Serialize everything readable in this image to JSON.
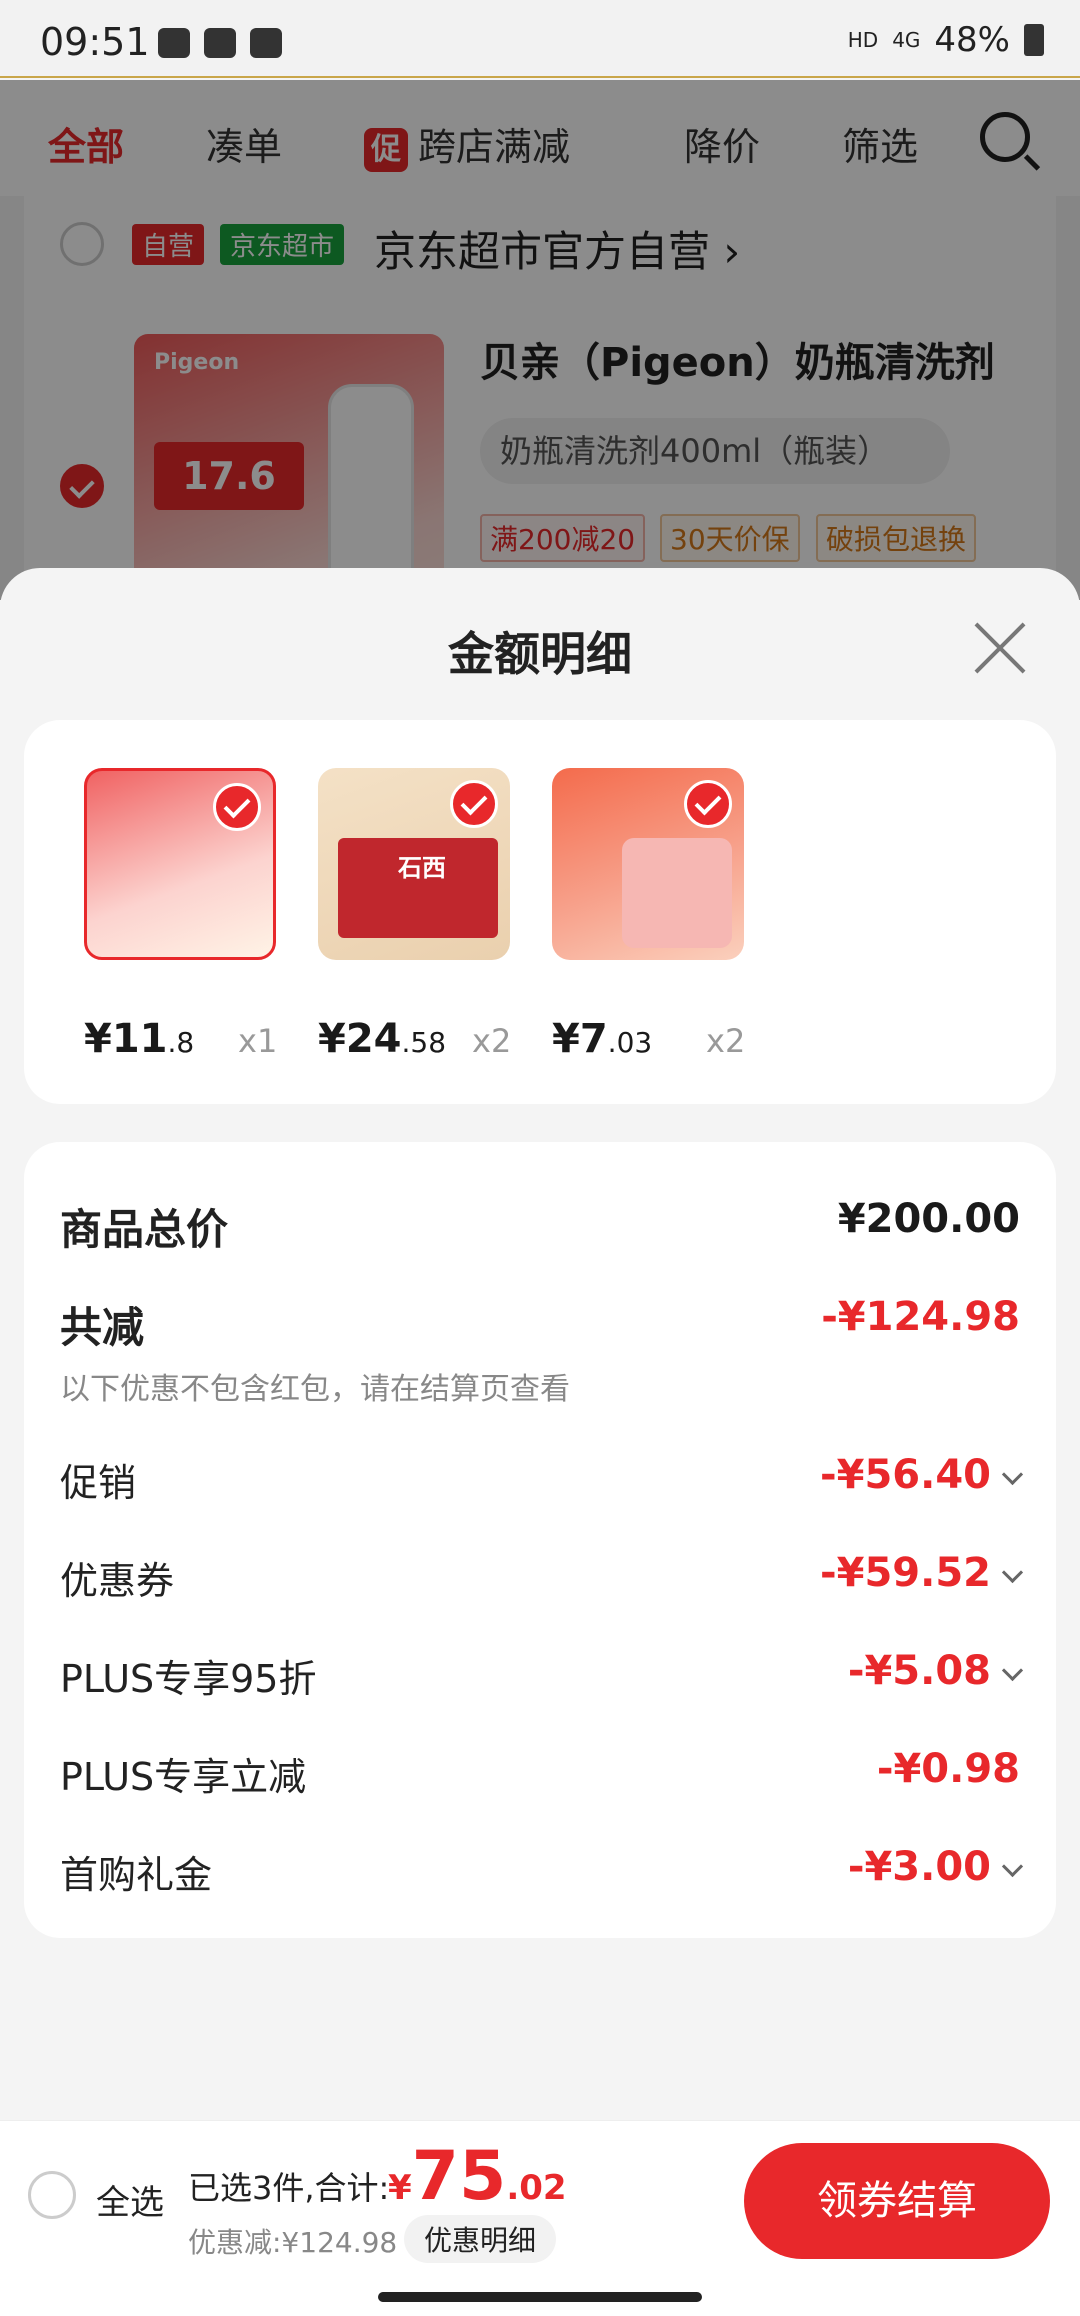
{
  "status_bar": {
    "time": "09:51",
    "net": "HD",
    "signal": "4G",
    "battery": "48%"
  },
  "top_tabs": {
    "all": "全部",
    "bundle": "凑单",
    "promo_badge": "促",
    "cross_store": "跨店满减",
    "price_drop": "降价",
    "filter": "筛选"
  },
  "shop": {
    "tag_self": "自营",
    "tag_market": "京东超市",
    "name": "京东超市官方自营 ›",
    "product": {
      "brand": "Pigeon",
      "image_price": "17.6",
      "title": "贝亲（Pigeon）奶瓶清洗剂",
      "spec": "奶瓶清洗剂400ml（瓶装）",
      "chips": [
        "满200减20",
        "30天价保",
        "破损包退换"
      ]
    }
  },
  "sheet": {
    "title": "金额明细",
    "items": [
      {
        "price_int": "¥11",
        "price_dec": ".8",
        "qty": "x1"
      },
      {
        "price_int": "¥24",
        "price_dec": ".58",
        "qty": "x2",
        "box_text": "石西"
      },
      {
        "price_int": "¥7",
        "price_dec": ".03",
        "qty": "x2"
      }
    ],
    "details": {
      "total_label": "商品总价",
      "total_value": "¥200.00",
      "reduced_label": "共减",
      "reduced_value": "-¥124.98",
      "note": "以下优惠不包含红包，请在结算页查看",
      "rows": [
        {
          "label": "促销",
          "value": "-¥56.40"
        },
        {
          "label": "优惠券",
          "value": "-¥59.52"
        },
        {
          "label": "PLUS专享95折",
          "value": "-¥5.08"
        },
        {
          "label": "PLUS专享立减",
          "value": "-¥0.98"
        },
        {
          "label": "首购礼金",
          "value": "-¥3.00"
        }
      ]
    }
  },
  "bottom": {
    "select_all": "全选",
    "selected": "已选3件,合计:",
    "currency": "¥",
    "total_int": "75",
    "total_dec": ".02",
    "discount": "优惠减:¥124.98",
    "detail_btn": "优惠明细",
    "pay_btn": "领券结算"
  },
  "colors": {
    "accent": "#e8282b",
    "green": "#19a23c"
  }
}
